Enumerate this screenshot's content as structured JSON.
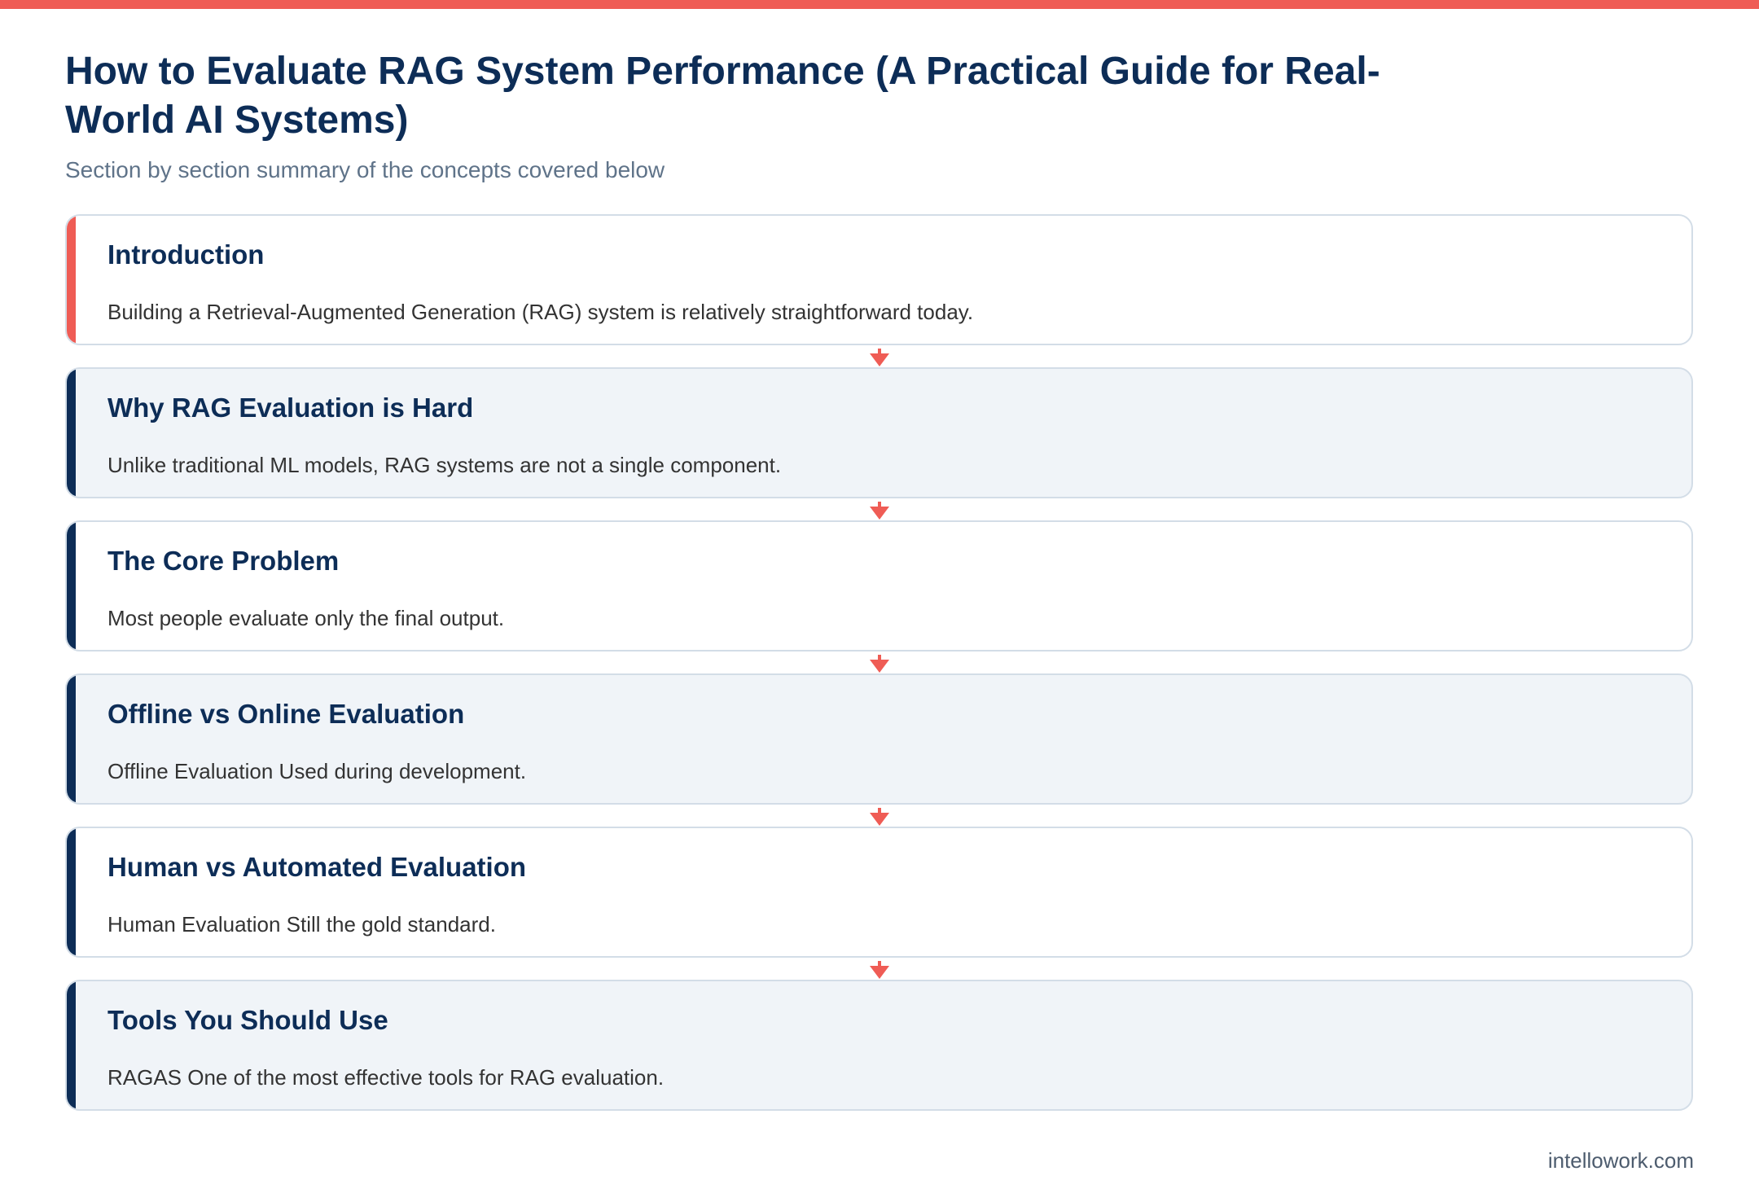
{
  "header": {
    "title": "How to Evaluate RAG System Performance (A Practical Guide for Real-World AI Systems)",
    "subtitle": "Section by section summary of the concepts covered below"
  },
  "colors": {
    "accent": "#ef5c55",
    "navy": "#0d2d57"
  },
  "sections": [
    {
      "title": "Introduction",
      "text": "Building a Retrieval-Augmented Generation (RAG) system is relatively straightforward today."
    },
    {
      "title": "Why RAG Evaluation is Hard",
      "text": "Unlike traditional ML models, RAG systems are not a single component."
    },
    {
      "title": "The Core Problem",
      "text": "Most people evaluate only the final output."
    },
    {
      "title": "Offline vs Online Evaluation",
      "text": "Offline Evaluation Used during development."
    },
    {
      "title": "Human vs Automated Evaluation",
      "text": "Human Evaluation Still the gold standard."
    },
    {
      "title": "Tools You Should Use",
      "text": "RAGAS One of the most effective tools for RAG evaluation."
    }
  ],
  "footer": {
    "site": "intellowork.com"
  }
}
